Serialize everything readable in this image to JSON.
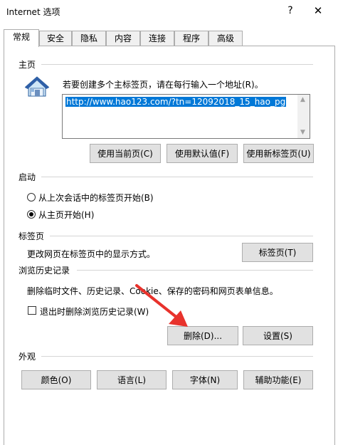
{
  "window": {
    "title": "Internet 选项",
    "help_glyph": "?",
    "close_glyph": "✕"
  },
  "tabs": [
    "常规",
    "安全",
    "隐私",
    "内容",
    "连接",
    "程序",
    "高级"
  ],
  "home": {
    "heading": "主页",
    "instruction": "若要创建多个主标签页，请在每行输入一个地址(R)。",
    "url": "http://www.hao123.com/?tn=12092018_15_hao_pg",
    "btn_current": "使用当前页(C)",
    "btn_default": "使用默认值(F)",
    "btn_newtab": "使用新标签页(U)"
  },
  "startup": {
    "heading": "启动",
    "option_last": "从上次会话中的标签页开始(B)",
    "option_home": "从主页开始(H)",
    "selected": "option_home"
  },
  "tabs_section": {
    "heading": "标签页",
    "description": "更改网页在标签页中的显示方式。",
    "btn": "标签页(T)"
  },
  "history": {
    "heading": "浏览历史记录",
    "description": "删除临时文件、历史记录、Cookie、保存的密码和网页表单信息。",
    "checkbox_label": "退出时删除浏览历史记录(W)",
    "checkbox_checked": false,
    "btn_delete": "删除(D)...",
    "btn_settings": "设置(S)"
  },
  "appearance": {
    "heading": "外观",
    "btn_colors": "颜色(O)",
    "btn_languages": "语言(L)",
    "btn_fonts": "字体(N)",
    "btn_accessibility": "辅助功能(E)"
  },
  "colors": {
    "accent": "#0078d7",
    "annotation_arrow": "#e8322c"
  }
}
